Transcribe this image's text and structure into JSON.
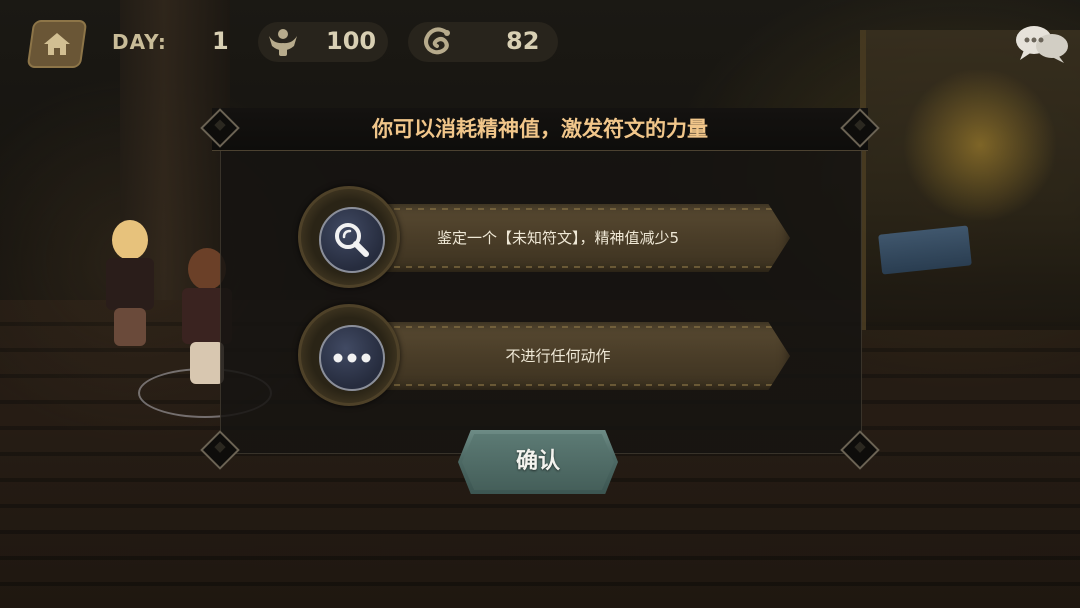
{
  "hud": {
    "day_label": "DAY:",
    "day_value": "1",
    "stat1_value": "100",
    "stat2_value": "82",
    "icons": [
      "home-icon",
      "spirit-figure-icon",
      "coin-swirl-icon",
      "chat-bubbles-icon"
    ]
  },
  "dialog": {
    "title": "你可以消耗精神值，激发符文的力量",
    "options": [
      {
        "icon": "magnifier-icon",
        "label": "鉴定一个【未知符文】，精神值减少5"
      },
      {
        "icon": "ellipsis-icon",
        "label": "不进行任何动作"
      }
    ],
    "confirm_label": "确认"
  },
  "colors": {
    "title_text": "#f1c68a",
    "banner": "#4a3d28",
    "confirm_button": "#4e6a65",
    "icon_disc": "#2f3548"
  }
}
